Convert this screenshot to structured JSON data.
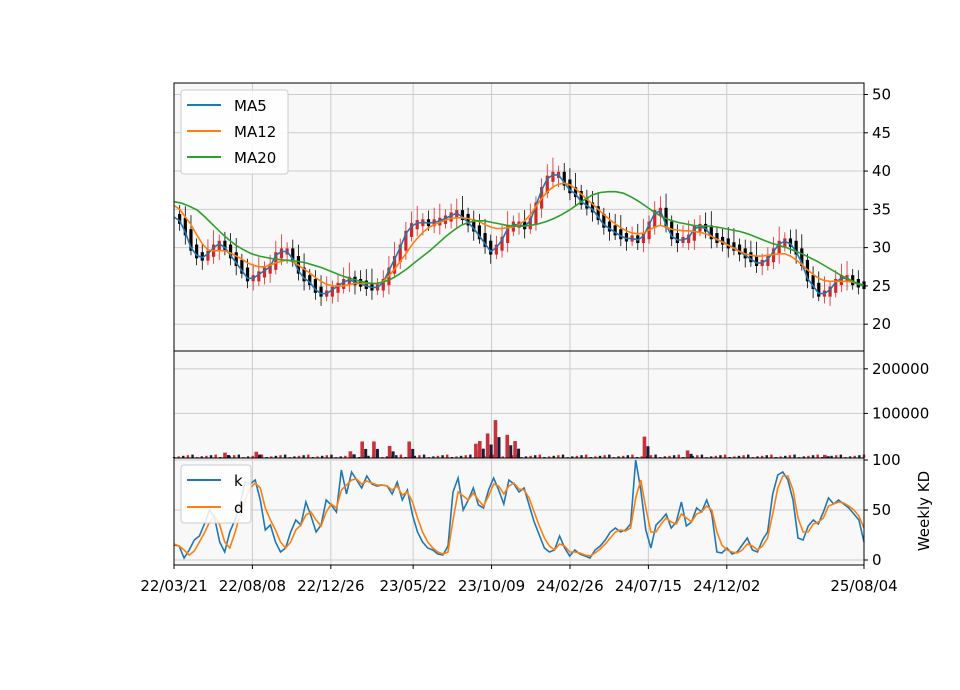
{
  "chart_data": [
    {
      "type": "candlestick",
      "panel": "price",
      "ylim": [
        16.5,
        51.5
      ],
      "y_ticks": [
        20,
        25,
        30,
        35,
        40,
        45,
        50
      ],
      "grid": true,
      "legend_location": "top-left",
      "legend": [
        {
          "name": "MA5",
          "color": "#1f77b4"
        },
        {
          "name": "MA12",
          "color": "#ff7f0e"
        },
        {
          "name": "MA20",
          "color": "#2ca02c"
        }
      ],
      "up_color": "#d62728",
      "down_color": "#000000",
      "ma5": [
        34,
        33.5,
        32,
        30,
        29,
        28.7,
        29.2,
        30,
        30.5,
        30,
        29,
        28,
        27,
        26,
        26,
        26.5,
        27,
        27.5,
        29,
        29.5,
        29.5,
        28.5,
        27,
        26,
        25.5,
        24.5,
        24,
        24,
        24.5,
        25,
        25.5,
        25.8,
        25.5,
        25.3,
        25,
        24.8,
        24.8,
        25.5,
        27,
        28.5,
        30,
        31.8,
        32.8,
        33.2,
        33.3,
        33.2,
        33.3,
        33.5,
        33.8,
        34.2,
        34.5,
        34,
        33.3,
        32.5,
        31.5,
        30.5,
        29.5,
        30,
        31,
        32.5,
        33,
        33,
        32.8,
        33.5,
        35.5,
        37.5,
        39,
        39.5,
        39.5,
        38.5,
        37.5,
        37,
        36,
        35.5,
        35,
        34,
        33,
        32.5,
        32,
        31.5,
        31.2,
        31.2,
        31,
        31.5,
        33,
        34.5,
        34.8,
        33,
        31.5,
        31,
        31,
        31.3,
        32.5,
        32.7,
        32.5,
        31.5,
        31,
        30.8,
        30.3,
        30,
        29.5,
        29,
        28.5,
        28,
        28,
        28.5,
        29.5,
        30.5,
        30.8,
        30.5,
        29.5,
        28,
        26,
        25,
        24,
        24,
        24.5,
        25.5,
        26,
        26,
        25.5,
        25.2,
        25
      ],
      "ma12": [
        35.5,
        35,
        34,
        33,
        31.7,
        30.5,
        29.7,
        29.6,
        29.6,
        29.6,
        29.3,
        28.9,
        28.5,
        28,
        27.7,
        27.5,
        27.5,
        27.7,
        28,
        28.2,
        28.4,
        28.2,
        27.7,
        27.2,
        26.7,
        26.1,
        25.6,
        25.2,
        25,
        25,
        25,
        25.2,
        25.3,
        25.3,
        25.3,
        25.3,
        25.3,
        25.6,
        26.3,
        27.2,
        28.2,
        29.2,
        30.3,
        31.2,
        32,
        32.6,
        33,
        33.3,
        33.6,
        33.8,
        33.9,
        33.9,
        33.8,
        33.6,
        33.4,
        33,
        32.7,
        32.5,
        32.5,
        32.6,
        32.7,
        33,
        33.5,
        34.3,
        35.4,
        36.4,
        37.3,
        37.9,
        38.3,
        38.4,
        38.2,
        37.7,
        37,
        36.3,
        35.7,
        35,
        34.3,
        33.7,
        33.1,
        32.6,
        32.2,
        31.9,
        31.8,
        31.9,
        32.3,
        32.7,
        32.9,
        32.7,
        32.4,
        32.3,
        32.2,
        32.2,
        32.1,
        32,
        31.8,
        31.5,
        31.1,
        30.7,
        30.3,
        29.9,
        29.5,
        29.2,
        29,
        28.9,
        28.9,
        29,
        29.1,
        29.2,
        29.2,
        28.9,
        28.4,
        27.8,
        27.1,
        26.5,
        26,
        25.7,
        25.6,
        25.6,
        25.6,
        25.6,
        25.5,
        25.3,
        25.1
      ],
      "ma20": [
        36,
        35.8,
        35.4,
        34.9,
        34,
        33,
        32,
        31.1,
        30.3,
        29.7,
        29.2,
        28.9,
        28.7,
        28.5,
        28.4,
        28.3,
        28.2,
        28,
        27.7,
        27.4,
        27,
        26.6,
        26.2,
        25.9,
        25.6,
        25.4,
        25.3,
        25.5,
        25.9,
        26.5,
        27.2,
        28,
        28.8,
        29.6,
        30.5,
        31.4,
        32.2,
        32.9,
        33.3,
        33.5,
        33.5,
        33.3,
        33.1,
        32.9,
        32.8,
        32.8,
        32.9,
        33.1,
        33.4,
        33.8,
        34.3,
        34.9,
        35.6,
        36.3,
        36.9,
        37.2,
        37.3,
        37.3,
        37.1,
        36.6,
        36,
        35.3,
        34.6,
        34,
        33.6,
        33.3,
        33.1,
        32.9,
        32.8,
        32.8,
        32.7,
        32.5,
        32.3,
        32.1,
        31.8,
        31.4,
        31,
        30.6,
        30.3,
        30,
        29.6,
        29.2,
        28.7,
        28.2,
        27.6,
        27,
        26.4,
        25.9,
        25.4,
        25.1
      ]
    },
    {
      "type": "bar",
      "panel": "volume",
      "ylim": [
        0,
        240000
      ],
      "y_ticks": [
        100000,
        200000
      ],
      "grid": true,
      "peaks": [
        {
          "x": "22/06/20",
          "value": 12000
        },
        {
          "x": "22/08/15",
          "value": 14000
        },
        {
          "x": "23/01/30",
          "value": 15000
        },
        {
          "x": "23/02/20",
          "value": 37000
        },
        {
          "x": "23/03/13",
          "value": 37000
        },
        {
          "x": "23/04/10",
          "value": 27000
        },
        {
          "x": "23/05/15",
          "value": 37000
        },
        {
          "x": "23/09/11",
          "value": 32000
        },
        {
          "x": "23/09/18",
          "value": 38000
        },
        {
          "x": "23/10/02",
          "value": 55000
        },
        {
          "x": "23/10/16",
          "value": 85000
        },
        {
          "x": "23/11/06",
          "value": 52000
        },
        {
          "x": "23/11/20",
          "value": 38000
        },
        {
          "x": "24/07/08",
          "value": 48000
        },
        {
          "x": "24/09/23",
          "value": 17000
        },
        {
          "x": "25/05/26",
          "value": 7000
        }
      ]
    },
    {
      "type": "line",
      "panel": "kd",
      "ylim": [
        -5,
        102
      ],
      "y_ticks": [
        0,
        50,
        100
      ],
      "ylabel": "Weekly KD",
      "grid": true,
      "legend_location": "top-left",
      "x_tick_labels": [
        "22/03/21",
        "22/08/08",
        "22/12/26",
        "23/05/22",
        "23/10/09",
        "24/02/26",
        "24/07/15",
        "24/12/02",
        "25/08/04"
      ],
      "series": [
        {
          "name": "k",
          "color": "#1f77b4",
          "values": [
            15,
            14,
            2,
            10,
            20,
            24,
            36,
            50,
            42,
            18,
            8,
            28,
            40,
            55,
            78,
            76,
            80,
            60,
            30,
            35,
            18,
            8,
            12,
            28,
            40,
            35,
            58,
            44,
            28,
            35,
            60,
            55,
            48,
            90,
            66,
            88,
            80,
            72,
            84,
            76,
            74,
            75,
            74,
            66,
            78,
            60,
            70,
            45,
            28,
            18,
            12,
            10,
            6,
            5,
            14,
            68,
            82,
            50,
            60,
            72,
            55,
            52,
            70,
            82,
            70,
            56,
            80,
            76,
            68,
            72,
            55,
            38,
            25,
            12,
            8,
            10,
            24,
            12,
            4,
            10,
            6,
            4,
            2,
            10,
            14,
            20,
            28,
            32,
            28,
            30,
            36,
            100,
            70,
            30,
            12,
            35,
            40,
            46,
            32,
            38,
            58,
            34,
            38,
            52,
            48,
            60,
            46,
            8,
            7,
            12,
            6,
            8,
            15,
            22,
            10,
            8,
            20,
            28,
            66,
            85,
            88,
            80,
            60,
            22,
            20,
            34,
            40,
            36,
            48,
            62,
            56,
            60,
            56,
            52,
            46,
            40,
            18
          ]
        },
        {
          "name": "d",
          "color": "#ff7f0e",
          "values": [
            16,
            14,
            10,
            5,
            9,
            18,
            27,
            38,
            44,
            35,
            18,
            12,
            27,
            45,
            60,
            72,
            77,
            72,
            52,
            40,
            30,
            18,
            12,
            18,
            30,
            35,
            45,
            48,
            40,
            34,
            48,
            56,
            52,
            70,
            75,
            80,
            81,
            76,
            79,
            77,
            75,
            75,
            74,
            70,
            74,
            65,
            68,
            58,
            42,
            28,
            18,
            12,
            8,
            6,
            8,
            40,
            68,
            64,
            60,
            67,
            60,
            54,
            64,
            76,
            74,
            66,
            74,
            77,
            71,
            70,
            62,
            48,
            34,
            22,
            14,
            10,
            16,
            14,
            8,
            8,
            7,
            5,
            4,
            7,
            11,
            16,
            22,
            28,
            30,
            29,
            32,
            62,
            80,
            52,
            28,
            28,
            36,
            42,
            38,
            36,
            46,
            42,
            38,
            46,
            48,
            54,
            50,
            28,
            15,
            10,
            8,
            7,
            10,
            16,
            14,
            10,
            14,
            22,
            46,
            72,
            84,
            84,
            70,
            42,
            28,
            28,
            36,
            38,
            42,
            54,
            56,
            58,
            57,
            54,
            50,
            44,
            32
          ]
        }
      ]
    }
  ]
}
